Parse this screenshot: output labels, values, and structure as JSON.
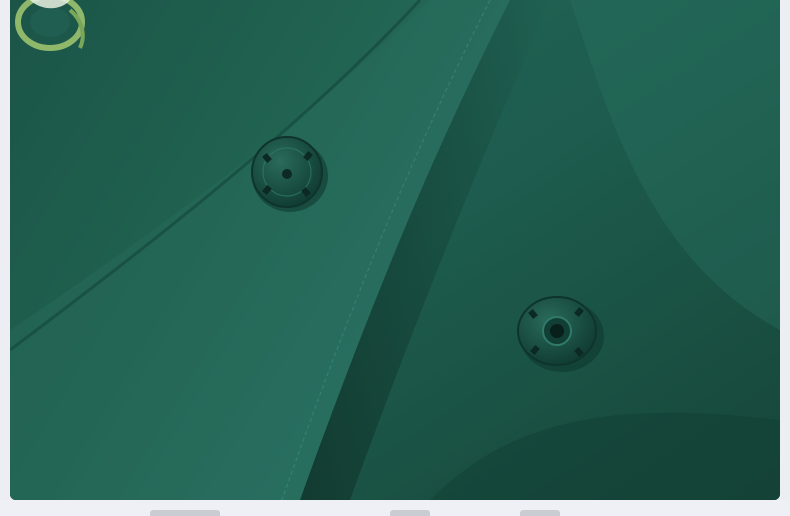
{
  "image": {
    "subject": "",
    "colors": {
      "fabric_main": "#1f5e50",
      "fabric_dark": "#153f36",
      "fabric_light": "#2b7262",
      "snap_button": "#174a3f",
      "embroidery": "#8fb86b",
      "background": "#eceef3"
    }
  }
}
